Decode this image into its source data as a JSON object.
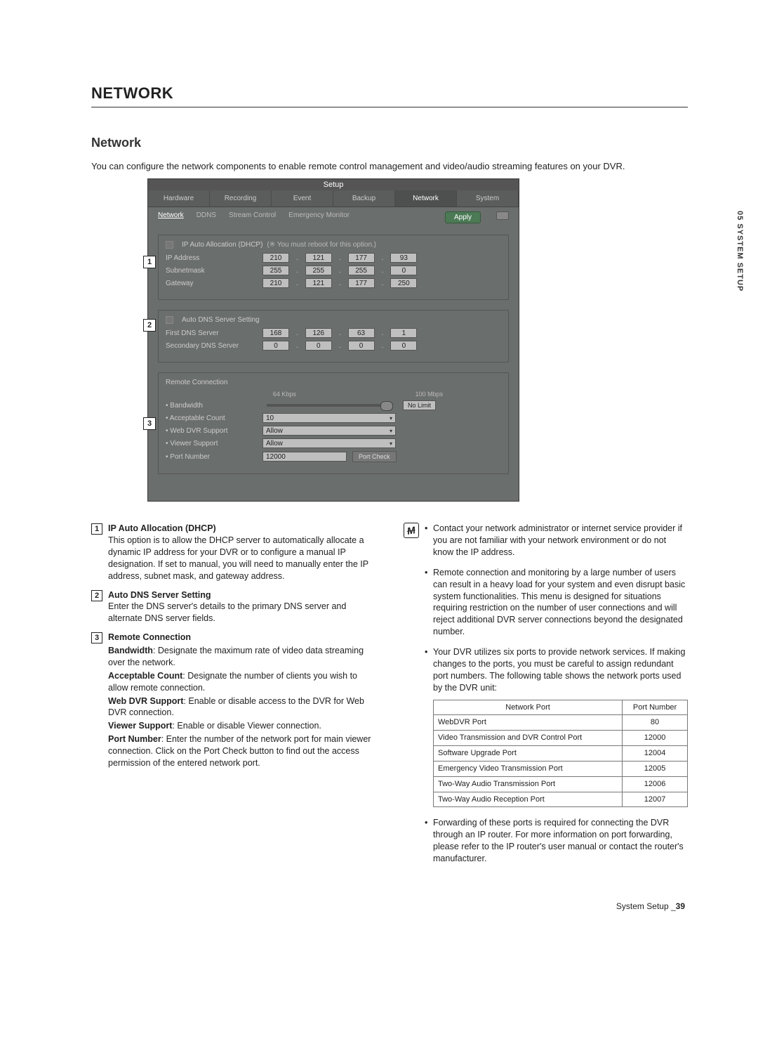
{
  "sideLabel": "05 SYSTEM SETUP",
  "chapterTitle": "NETWORK",
  "sectionTitle": "Network",
  "intro": "You can configure the network components to enable remote control management and video/audio streaming features on your DVR.",
  "shot": {
    "windowTitle": "Setup",
    "tabs": [
      "Hardware",
      "Recording",
      "Event",
      "Backup",
      "Network",
      "System"
    ],
    "activeTab": "Network",
    "subTabs": [
      "Network",
      "DDNS",
      "Stream Control",
      "Emergency Monitor"
    ],
    "activeSubTab": "Network",
    "applyLabel": "Apply",
    "dhcp": {
      "label": "IP Auto Allocation (DHCP)",
      "note": "(※ You must reboot for this option.)",
      "rows": [
        {
          "label": "IP Address",
          "oct": [
            "210",
            "121",
            "177",
            "93"
          ]
        },
        {
          "label": "Subnetmask",
          "oct": [
            "255",
            "255",
            "255",
            "0"
          ]
        },
        {
          "label": "Gateway",
          "oct": [
            "210",
            "121",
            "177",
            "250"
          ]
        }
      ]
    },
    "dns": {
      "label": "Auto DNS Server Setting",
      "rows": [
        {
          "label": "First DNS Server",
          "oct": [
            "168",
            "126",
            "63",
            "1"
          ]
        },
        {
          "label": "Secondary DNS Server",
          "oct": [
            "0",
            "0",
            "0",
            "0"
          ]
        }
      ]
    },
    "remote": {
      "title": "Remote Connection",
      "bwLeft": "64 Kbps",
      "bwRight": "100 Mbps",
      "noLimit": "No Limit",
      "rows": [
        {
          "label": "Bandwidth"
        },
        {
          "label": "Acceptable Count",
          "value": "10"
        },
        {
          "label": "Web DVR Support",
          "value": "Allow"
        },
        {
          "label": "Viewer Support",
          "value": "Allow"
        },
        {
          "label": "Port Number",
          "value": "12000"
        }
      ],
      "portCheck": "Port Check"
    }
  },
  "desc": {
    "n1": {
      "title": "IP Auto Allocation (DHCP)",
      "body": "This option is to allow the DHCP server to automatically allocate a dynamic IP address for your DVR or to configure a manual IP designation. If set to manual, you will need to manually enter the IP address, subnet mask, and gateway address."
    },
    "n2": {
      "title": "Auto DNS Server Setting",
      "body": "Enter the DNS server's details to the primary DNS server and alternate DNS server fields."
    },
    "n3": {
      "title": "Remote Connection",
      "bandwidth": {
        "term": "Bandwidth",
        "body": ": Designate the maximum rate of video data streaming over the network."
      },
      "acceptable": {
        "term": "Acceptable Count",
        "body": ": Designate the number of clients you wish to allow remote connection."
      },
      "webdvr": {
        "term": "Web DVR Support",
        "body": ": Enable or disable access to the DVR for Web DVR connection."
      },
      "viewer": {
        "term": "Viewer Support",
        "body": ": Enable or disable Viewer connection."
      },
      "port": {
        "term": "Port Number",
        "body": ": Enter the number of the network port for main viewer connection. Click on the Port Check button to find out the access permission of the entered network port."
      }
    },
    "notes": {
      "n1": "Contact your network administrator or internet service provider if you are not familiar with your network environment or do not know the IP address.",
      "n2": "Remote connection and monitoring by a large number of users can result in a heavy load for your system and even disrupt basic system functionalities. This menu is designed for situations requiring restriction on the number of user connections and will reject additional DVR server connections beyond the designated number.",
      "n3": "Your DVR utilizes six ports to provide network services. If making changes to the ports, you must be careful to assign redundant port numbers. The following table shows the network ports used by the DVR unit:",
      "n4": "Forwarding of these ports is required for connecting the DVR through an IP router. For more information on port forwarding, please refer to the IP router's user manual or contact the router's manufacturer."
    },
    "portsTable": {
      "h1": "Network Port",
      "h2": "Port Number",
      "rows": [
        {
          "name": "WebDVR Port",
          "num": "80"
        },
        {
          "name": "Video Transmission and DVR Control Port",
          "num": "12000"
        },
        {
          "name": "Software Upgrade Port",
          "num": "12004"
        },
        {
          "name": "Emergency Video Transmission Port",
          "num": "12005"
        },
        {
          "name": "Two-Way Audio Transmission Port",
          "num": "12006"
        },
        {
          "name": "Two-Way Audio Reception Port",
          "num": "12007"
        }
      ]
    }
  },
  "footer": {
    "label": "System Setup _",
    "page": "39"
  }
}
